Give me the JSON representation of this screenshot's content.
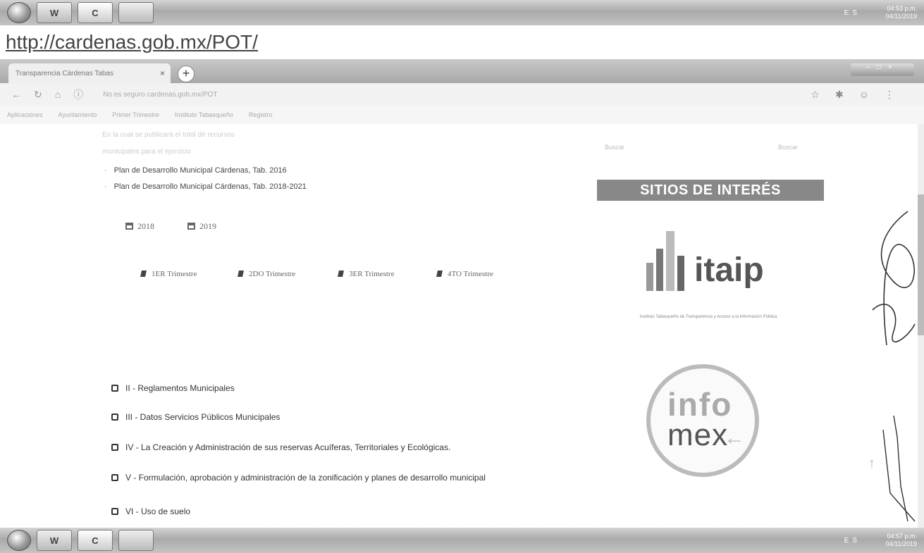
{
  "taskbar_top": {
    "apps": [
      "W",
      "C",
      ""
    ],
    "tray": "ES",
    "time": "04:53 p.m.",
    "date": "04/11/2019"
  },
  "taskbar_bottom": {
    "apps": [
      "W",
      "C",
      ""
    ],
    "tray": "ES",
    "time": "04:57 p.m.",
    "date": "04/11/2019"
  },
  "url_caption": "http://cardenas.gob.mx/POT/",
  "browser": {
    "tab_title": "Transparencia Cárdenas Tabas",
    "tab_close": "×",
    "new_tab": "+",
    "address": "No es seguro   cardenas.gob.mx/POT",
    "bookmarks": [
      "Aplicaciones",
      "Ayuntamiento",
      "Primer Trimestre",
      "Instituto Tabasqueño",
      "Registro"
    ]
  },
  "page": {
    "faded_line1": "En la cual se publicará el total de recursos",
    "faded_line2": "municipales para el ejercicio",
    "plans": [
      "Plan de Desarrollo Municipal Cárdenas, Tab. 2016",
      "Plan de Desarrollo Municipal Cárdenas, Tab. 2018-2021"
    ],
    "years": [
      "2018",
      "2019"
    ],
    "trimestres": [
      "1ER Trimestre",
      "2DO Trimestre",
      "3ER Trimestre",
      "4TO Trimestre"
    ],
    "sections": [
      "II - Reglamentos Municipales",
      "III - Datos Servicios Públicos Municipales",
      "IV - La Creación y Administración de sus reservas Acuíferas, Territoriales y Ecológicas.",
      "V - Formulación, aprobación y administración de la zonificación y planes de desarrollo municipal",
      "VI - Uso de suelo"
    ]
  },
  "sidebar": {
    "search_left": "Buscar",
    "search_right": "Buscar",
    "sitios_title": "SITIOS DE INTERÉS",
    "itaip_word": "itaip",
    "itaip_subtitle": "Instituto Tabasqueño de Transparencia y Acceso a la Información Pública",
    "infomex_top": "info",
    "infomex_bottom": "mex"
  },
  "colors": {
    "banner": "#888888",
    "scan_tone": "grayscale"
  }
}
